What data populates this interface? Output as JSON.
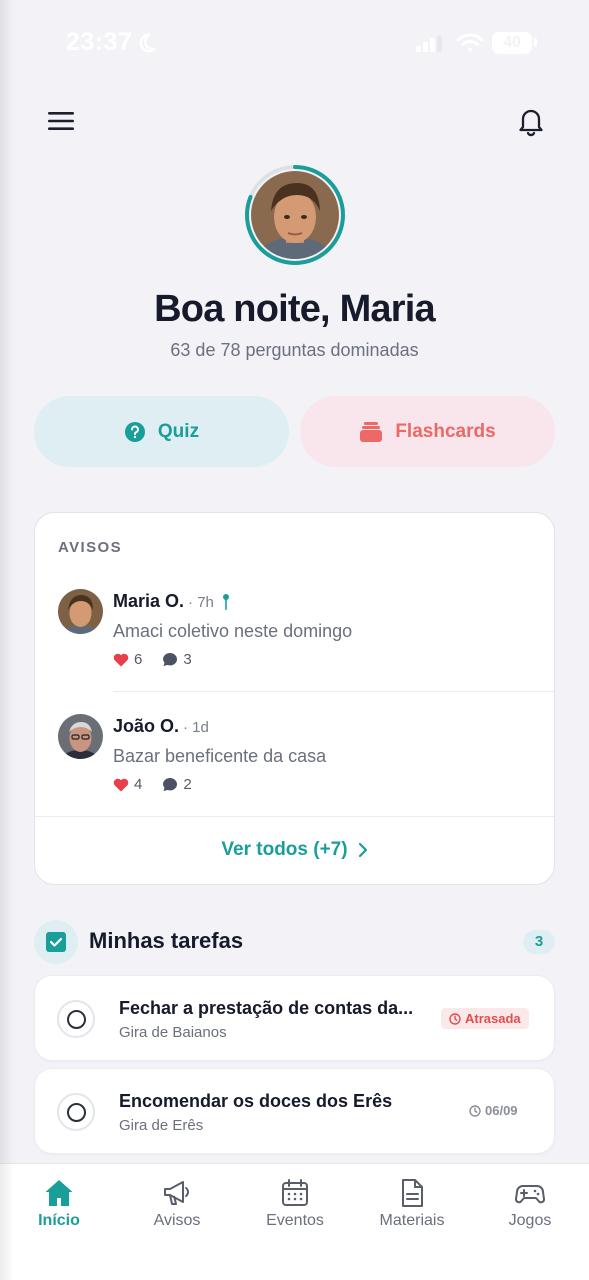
{
  "status_bar": {
    "time": "23:37",
    "battery": "40",
    "icons": [
      "moon-icon",
      "signal-icon",
      "wifi-icon",
      "battery-icon"
    ]
  },
  "header": {
    "menu_icon": "hamburger-menu-icon",
    "notification_icon": "bell-icon"
  },
  "profile": {
    "greeting": "Boa noite, Maria",
    "progress_text": "63 de 78 perguntas dominadas",
    "progress_fraction": 0.81,
    "ring_color": "#1a9e9a"
  },
  "actions": {
    "quiz": {
      "label": "Quiz",
      "icon": "question-circle-icon",
      "color": "#1a9e9a"
    },
    "flashcards": {
      "label": "Flashcards",
      "icon": "cards-stack-icon",
      "color": "#ec6966"
    }
  },
  "notices": {
    "title": "AVISOS",
    "posts": [
      {
        "author": "Maria O.",
        "time": "· 7h",
        "pinned": true,
        "text": "Amaci coletivo neste domingo",
        "likes": "6",
        "comments": "3"
      },
      {
        "author": "João O.",
        "time": "· 1d",
        "pinned": false,
        "text": "Bazar beneficente da casa",
        "likes": "4",
        "comments": "2"
      }
    ],
    "see_all": "Ver todos (+7)"
  },
  "tasks": {
    "title": "Minhas tarefas",
    "count": "3",
    "items": [
      {
        "title": "Fechar a prestação de contas da...",
        "subtitle": "Gira de Baianos",
        "badge": "Atrasada",
        "badge_type": "late"
      },
      {
        "title": "Encomendar os doces dos Erês",
        "subtitle": "Gira de Erês",
        "badge": "06/09",
        "badge_type": "date"
      }
    ]
  },
  "bottom_nav": {
    "items": [
      {
        "label": "Início",
        "icon": "home-icon",
        "active": true
      },
      {
        "label": "Avisos",
        "icon": "megaphone-icon",
        "active": false
      },
      {
        "label": "Eventos",
        "icon": "calendar-icon",
        "active": false
      },
      {
        "label": "Materiais",
        "icon": "document-icon",
        "active": false
      },
      {
        "label": "Jogos",
        "icon": "gamepad-icon",
        "active": false
      }
    ]
  },
  "colors": {
    "accent": "#1a9e9a",
    "danger": "#ec6966",
    "background": "#f3f3f7"
  }
}
